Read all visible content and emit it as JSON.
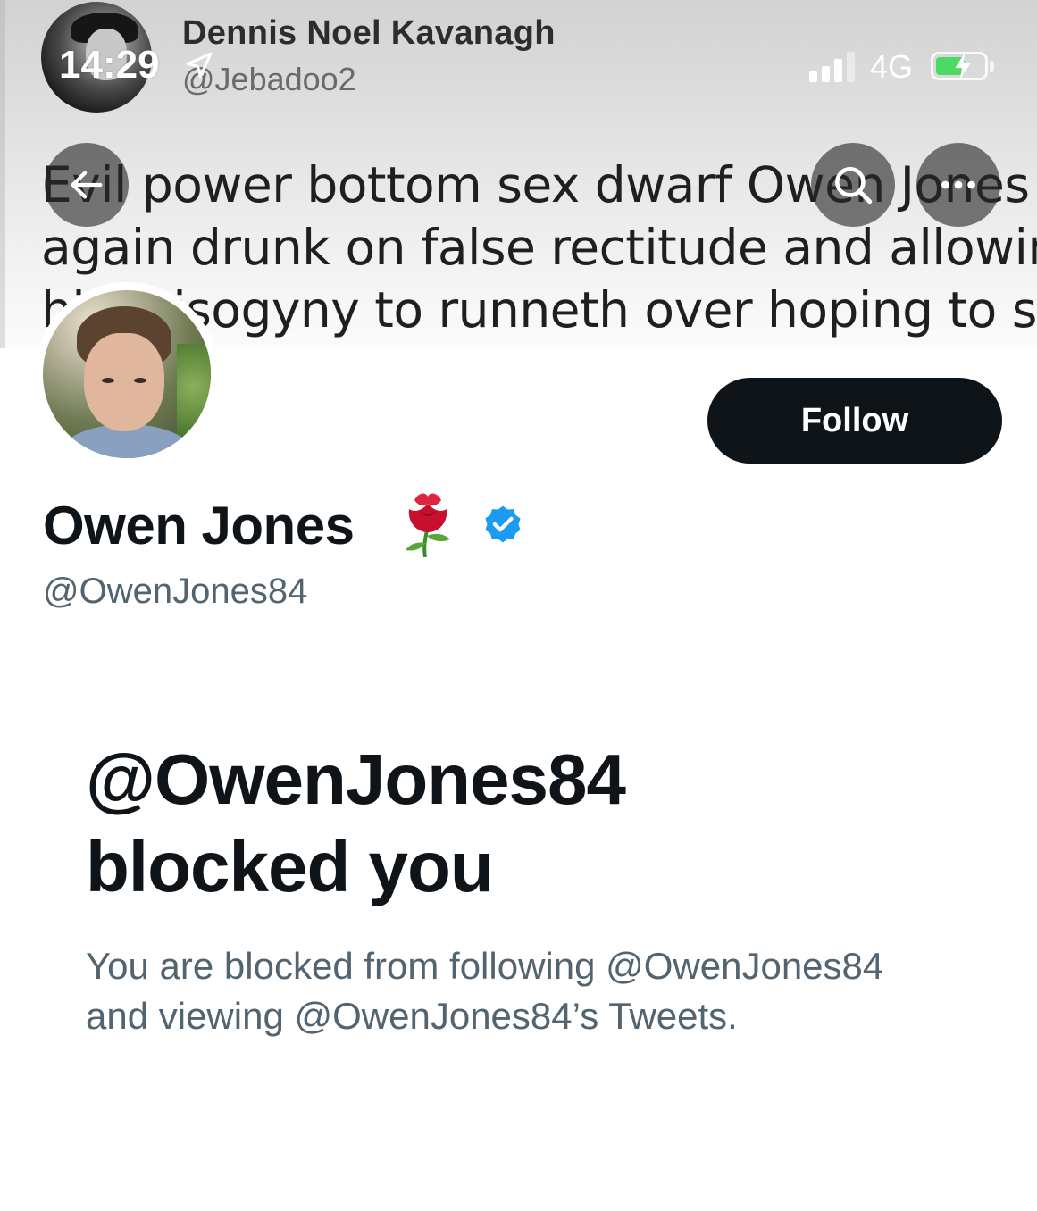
{
  "status_bar": {
    "time": "14:29",
    "network": "4G",
    "icons": [
      "location-arrow-icon",
      "signal-bars-icon",
      "battery-charging-icon"
    ]
  },
  "banner": {
    "tweet_author_name": "Dennis Noel Kavanagh",
    "tweet_author_handle": "@Jebadoo2",
    "tweet_lines": [
      "Evil power bottom sex dwarf Owen Jones",
      "again drunk on false rectitude and allowin",
      "his misogyny to runneth over hoping to sp"
    ]
  },
  "nav": {
    "back_icon": "arrow-left-icon",
    "search_icon": "search-icon",
    "more_icon": "more-horizontal-icon"
  },
  "profile": {
    "display_name": "Owen Jones",
    "name_emoji": "rose-icon",
    "verified_icon": "verified-badge-icon",
    "handle": "@OwenJones84",
    "follow_label": "Follow"
  },
  "blocked": {
    "title_line1": "@OwenJones84",
    "title_line2": "blocked you",
    "description_line1": "You are blocked from following @OwenJones84",
    "description_line2": "and viewing @OwenJones84’s Tweets."
  },
  "colors": {
    "text_primary": "#0f1419",
    "text_secondary": "#536471",
    "verified_blue": "#1d9bf0",
    "button_bg": "#0f1419",
    "battery_green": "#4cd964"
  }
}
